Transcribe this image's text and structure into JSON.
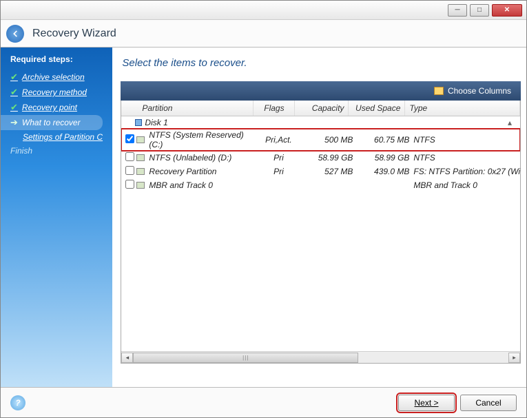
{
  "window": {
    "title": "Recovery Wizard"
  },
  "sidebar": {
    "heading": "Required steps:",
    "steps": [
      {
        "label": "Archive selection",
        "done": true
      },
      {
        "label": "Recovery method",
        "done": true
      },
      {
        "label": "Recovery point",
        "done": true
      },
      {
        "label": "What to recover",
        "current": true
      },
      {
        "label": "Settings of Partition C",
        "sub": true
      },
      {
        "label": "Finish",
        "future": true
      }
    ]
  },
  "content": {
    "title": "Select the items to recover.",
    "choose_columns": "Choose Columns"
  },
  "columns": {
    "partition": "Partition",
    "flags": "Flags",
    "capacity": "Capacity",
    "used": "Used Space",
    "type": "Type"
  },
  "disk": {
    "label": "Disk 1"
  },
  "rows": [
    {
      "checked": true,
      "name": "NTFS (System Reserved) (C:)",
      "flags": "Pri,Act.",
      "capacity": "500 MB",
      "used": "60.75 MB",
      "type": "NTFS",
      "highlight": true
    },
    {
      "checked": false,
      "name": "NTFS (Unlabeled) (D:)",
      "flags": "Pri",
      "capacity": "58.99 GB",
      "used": "58.99 GB",
      "type": "NTFS"
    },
    {
      "checked": false,
      "name": "Recovery Partition",
      "flags": "Pri",
      "capacity": "527 MB",
      "used": "439.0 MB",
      "type": "FS: NTFS Partition: 0x27 (Wi"
    },
    {
      "checked": false,
      "name": "MBR and Track 0",
      "flags": "",
      "capacity": "",
      "used": "",
      "type": "MBR and Track 0"
    }
  ],
  "footer": {
    "next": "Next >",
    "cancel": "Cancel"
  }
}
